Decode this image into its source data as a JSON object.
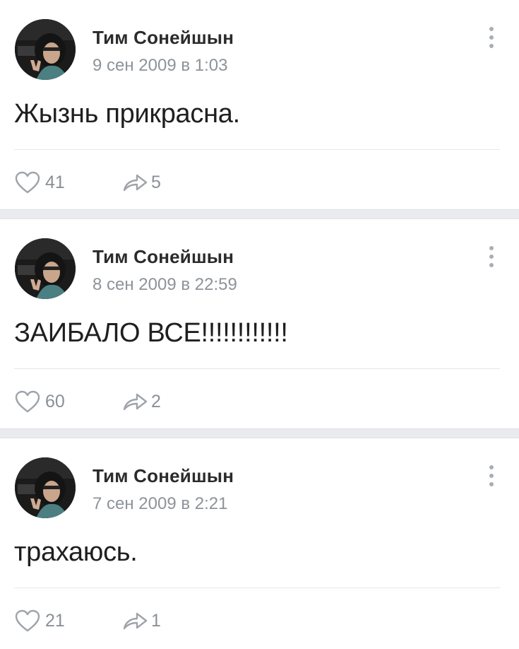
{
  "colors": {
    "text": "#1f1f1f",
    "author": "#2b2b2b",
    "muted": "#8d939a",
    "icon": "#9ea4aa",
    "separator": "#e9ebee"
  },
  "icons": {
    "more": "vertical-ellipsis",
    "like": "heart-outline",
    "share": "share-arrow"
  },
  "posts": [
    {
      "author": "Тим Сонейшын",
      "date": "9 сен 2009 в 1:03",
      "text": "Жызнь прикрасна.",
      "likes": "41",
      "shares": "5"
    },
    {
      "author": "Тим Сонейшын",
      "date": "8 сен 2009 в 22:59",
      "text": "ЗАИБАЛО ВСЕ!!!!!!!!!!!!",
      "likes": "60",
      "shares": "2"
    },
    {
      "author": "Тим Сонейшын",
      "date": "7 сен 2009 в 2:21",
      "text": "трахаюсь.",
      "likes": "21",
      "shares": "1"
    }
  ]
}
